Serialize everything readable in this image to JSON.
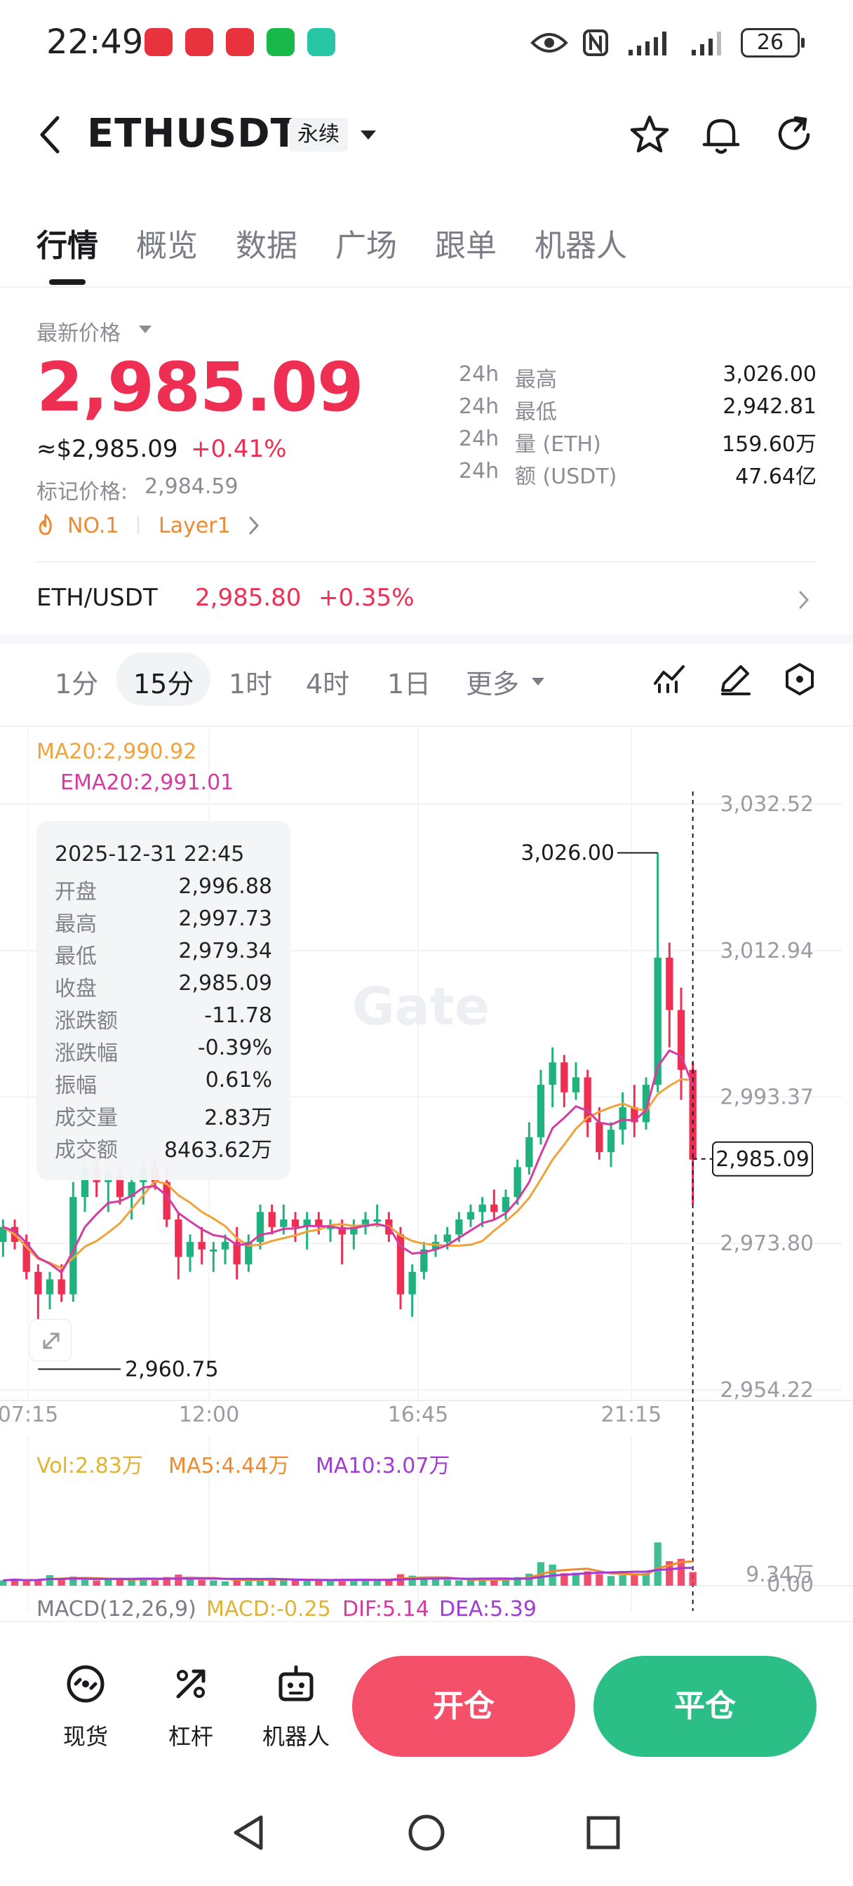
{
  "status_bar": {
    "time": "22:49",
    "battery": "26",
    "app_icons": [
      "huawei-app-icon",
      "huawei-app-icon",
      "huawei-app-icon",
      "wechat-icon",
      "app-icon"
    ]
  },
  "header": {
    "title": "ETHUSDT",
    "tag": "永续"
  },
  "tabs": [
    {
      "label": "行情",
      "active": true
    },
    {
      "label": "概览"
    },
    {
      "label": "数据"
    },
    {
      "label": "广场"
    },
    {
      "label": "跟单"
    },
    {
      "label": "机器人"
    }
  ],
  "price": {
    "label": "最新价格",
    "last": "2,985.09",
    "usd": "≈$2,985.09",
    "change_pct": "+0.41%",
    "mark_label": "标记价格:",
    "mark_value": "2,984.59",
    "rank": "NO.1",
    "sector": "Layer1"
  },
  "stats": [
    {
      "period": "24h",
      "label": "最高",
      "value": "3,026.00"
    },
    {
      "period": "24h",
      "label": "最低",
      "value": "2,942.81"
    },
    {
      "period": "24h",
      "label": "量 (ETH)",
      "value": "159.60万"
    },
    {
      "period": "24h",
      "label": "额 (USDT)",
      "value": "47.64亿"
    }
  ],
  "spot": {
    "pair": "ETH/USDT",
    "price": "2,985.80",
    "change": "+0.35%"
  },
  "intervals": [
    "1分",
    "15分",
    "1时",
    "4时",
    "1日",
    "更多"
  ],
  "active_interval": "15分",
  "indicators": {
    "ma20": "MA20:2,990.92",
    "ema20": "EMA20:2,991.01",
    "vol": "Vol:2.83万",
    "vol_ma5": "MA5:4.44万",
    "vol_ma10": "MA10:3.07万",
    "macd_title": "MACD(12,26,9)",
    "macd": "MACD:-0.25",
    "dif": "DIF:5.14",
    "dea": "DEA:5.39"
  },
  "tooltip": {
    "datetime": "2025-12-31 22:45",
    "rows": [
      {
        "label": "开盘",
        "value": "2,996.88"
      },
      {
        "label": "最高",
        "value": "2,997.73"
      },
      {
        "label": "最低",
        "value": "2,979.34"
      },
      {
        "label": "收盘",
        "value": "2,985.09"
      },
      {
        "label": "涨跌额",
        "value": "-11.78"
      },
      {
        "label": "涨跌幅",
        "value": "-0.39%"
      },
      {
        "label": "振幅",
        "value": "0.61%"
      },
      {
        "label": "成交量",
        "value": "2.83万"
      },
      {
        "label": "成交额",
        "value": "8463.62万"
      }
    ]
  },
  "chart_data": {
    "type": "candlestick",
    "price_axis": [
      "3,032.52",
      "3,012.94",
      "2,993.37",
      "2,973.80",
      "2,954.22"
    ],
    "time_axis": [
      "07:15",
      "12:00",
      "16:45",
      "21:15"
    ],
    "high_marker": "3,026.00",
    "low_marker": "2,960.75",
    "current_price": "2,985.09",
    "watermark": "Gate",
    "volume_axis": [
      "9.34万",
      "0.00"
    ],
    "ylim": [
      2954.22,
      3032.52
    ],
    "candles": [
      [
        2974,
        2977,
        2972,
        2976
      ],
      [
        2976,
        2977,
        2973,
        2974
      ],
      [
        2974,
        2975,
        2969,
        2970
      ],
      [
        2970,
        2971,
        2963,
        2967
      ],
      [
        2967,
        2970,
        2965,
        2969
      ],
      [
        2969,
        2971,
        2966,
        2967
      ],
      [
        2967,
        2982,
        2966,
        2980
      ],
      [
        2980,
        2986,
        2978,
        2984
      ],
      [
        2984,
        2986,
        2980,
        2982
      ],
      [
        2982,
        2984,
        2978,
        2983
      ],
      [
        2983,
        2984,
        2979,
        2980
      ],
      [
        2980,
        2983,
        2977,
        2982
      ],
      [
        2982,
        2985,
        2979,
        2984
      ],
      [
        2984,
        2985,
        2981,
        2982
      ],
      [
        2982,
        2984,
        2976,
        2977
      ],
      [
        2977,
        2978,
        2969,
        2972
      ],
      [
        2972,
        2975,
        2970,
        2974
      ],
      [
        2974,
        2976,
        2971,
        2973
      ],
      [
        2973,
        2974,
        2970,
        2973
      ],
      [
        2973,
        2975,
        2971,
        2974
      ],
      [
        2974,
        2976,
        2969,
        2971
      ],
      [
        2971,
        2975,
        2970,
        2974
      ],
      [
        2974,
        2979,
        2973,
        2978
      ],
      [
        2978,
        2979,
        2975,
        2976
      ],
      [
        2976,
        2979,
        2975,
        2977
      ],
      [
        2977,
        2978,
        2974,
        2976
      ],
      [
        2976,
        2978,
        2973,
        2977
      ],
      [
        2977,
        2978,
        2975,
        2976
      ],
      [
        2976,
        2977,
        2974,
        2976
      ],
      [
        2976,
        2977,
        2971,
        2975
      ],
      [
        2975,
        2977,
        2973,
        2976
      ],
      [
        2976,
        2978,
        2975,
        2977
      ],
      [
        2977,
        2979,
        2976,
        2977
      ],
      [
        2977,
        2978,
        2974,
        2975
      ],
      [
        2975,
        2976,
        2965,
        2967
      ],
      [
        2967,
        2971,
        2964,
        2970
      ],
      [
        2970,
        2974,
        2969,
        2973
      ],
      [
        2973,
        2975,
        2972,
        2974
      ],
      [
        2974,
        2976,
        2973,
        2975
      ],
      [
        2975,
        2978,
        2974,
        2977
      ],
      [
        2977,
        2979,
        2976,
        2978
      ],
      [
        2978,
        2980,
        2976,
        2979
      ],
      [
        2979,
        2981,
        2977,
        2978
      ],
      [
        2978,
        2981,
        2977,
        2980
      ],
      [
        2980,
        2985,
        2979,
        2984
      ],
      [
        2984,
        2990,
        2983,
        2988
      ],
      [
        2988,
        2997,
        2987,
        2995
      ],
      [
        2995,
        3000,
        2992,
        2998
      ],
      [
        2998,
        2999,
        2992,
        2994
      ],
      [
        2994,
        2998,
        2993,
        2996
      ],
      [
        2996,
        2997,
        2988,
        2990
      ],
      [
        2990,
        2992,
        2985,
        2986
      ],
      [
        2986,
        2990,
        2984,
        2989
      ],
      [
        2989,
        2994,
        2987,
        2992
      ],
      [
        2992,
        2995,
        2988,
        2990
      ],
      [
        2990,
        2996,
        2989,
        2995
      ],
      [
        2995,
        3026,
        2994,
        3012
      ],
      [
        3012,
        3014,
        3000,
        3005
      ],
      [
        3005,
        3008,
        2993,
        2997
      ],
      [
        2997,
        2998,
        2979,
        2985
      ]
    ],
    "volumes": [
      1.1,
      1.4,
      0.9,
      1.3,
      2.2,
      1.5,
      1.9,
      1.2,
      1.1,
      1.5,
      1.3,
      1.2,
      1.6,
      1.1,
      1.8,
      2.3,
      1.6,
      1.2,
      1.1,
      0.9,
      1.3,
      1.2,
      1.5,
      1.4,
      1.2,
      1.2,
      1.0,
      1.1,
      1.0,
      1.3,
      1.4,
      1.1,
      1.2,
      1.3,
      2.4,
      2.1,
      1.6,
      1.3,
      1.2,
      1.1,
      1.2,
      1.4,
      1.3,
      1.4,
      1.8,
      2.5,
      4.9,
      4.4,
      2.6,
      2.7,
      3.0,
      2.4,
      2.0,
      2.2,
      2.3,
      2.6,
      9.0,
      5.1,
      5.6,
      2.83
    ]
  },
  "bottom_bar": {
    "spot_label": "现货",
    "lever_label": "杠杆",
    "robot_label": "机器人",
    "open_label": "开仓",
    "close_label": "平仓"
  },
  "colors": {
    "up": "#1fb27f",
    "down": "#ee2e53",
    "ma20": "#f0a23b",
    "ema20": "#d63ba1",
    "vol_label": "#e0b431",
    "vol_ma5": "#f08a2e",
    "vol_ma10": "#a23bd6",
    "open_btn": "#f4506a",
    "close_btn": "#2bbf87"
  }
}
